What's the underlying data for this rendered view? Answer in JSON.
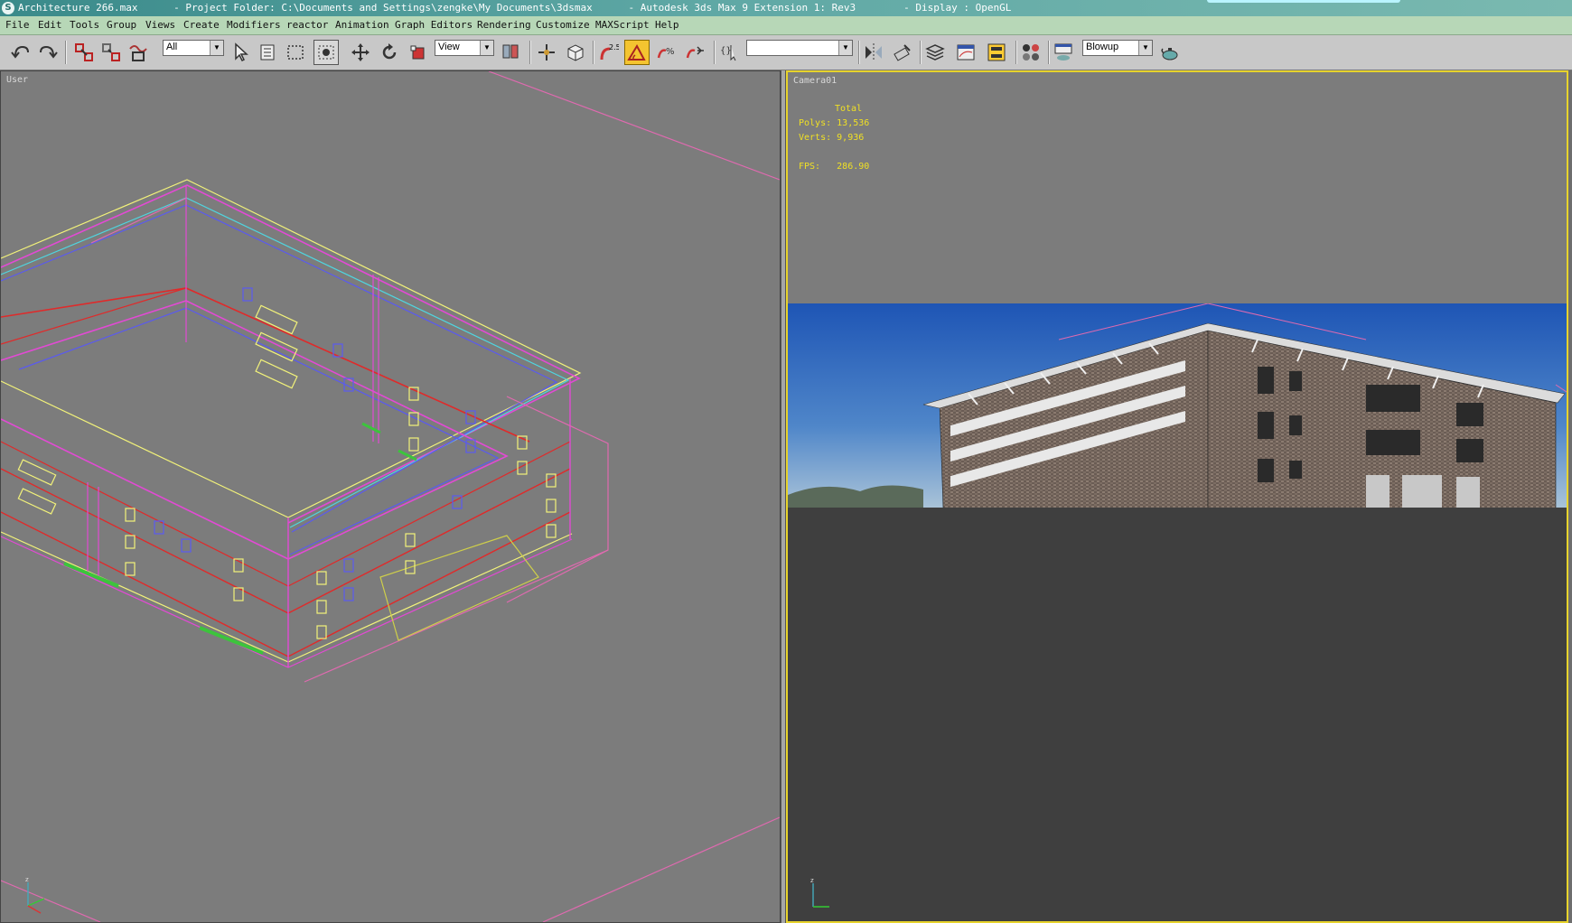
{
  "titlebar": {
    "icon_letter": "S",
    "title": "Architecture 266.max      - Project Folder: C:\\Documents and Settings\\zengke\\My Documents\\3dsmax      - Autodesk 3ds Max 9 Extension 1: Rev3        - Display : OpenGL"
  },
  "menu": {
    "items": [
      "File",
      "Edit",
      "Tools",
      "Group",
      "Views",
      "Create",
      "Modifiers",
      "reactor",
      "Animation",
      "Graph Editors",
      "Rendering",
      "Customize",
      "MAXScript",
      "Help"
    ]
  },
  "toolbar": {
    "selection_filter": "All",
    "reference_coord": "View",
    "named_selection": "",
    "render_type": "Blowup",
    "snap_label": "2.5",
    "icons": [
      "undo-icon",
      "redo-icon",
      "select-and-link-icon",
      "unlink-icon",
      "bind-space-warp-icon",
      "select-object-icon",
      "select-by-name-icon",
      "rectangular-selection-icon",
      "window-crossing-icon",
      "move-icon",
      "rotate-icon",
      "scale-icon",
      "pivot-center-icon",
      "select-manipulate-icon",
      "keyboard-shortcut-icon",
      "snaps-toggle-icon",
      "angle-snap-icon",
      "percent-snap-icon",
      "spinner-snap-icon",
      "edit-named-selection-icon",
      "mirror-icon",
      "align-icon",
      "layer-manager-icon",
      "curve-editor-icon",
      "schematic-view-icon",
      "material-editor-icon",
      "render-setup-icon",
      "quick-render-icon"
    ]
  },
  "viewports": {
    "left": {
      "label": "User"
    },
    "right": {
      "label": "Camera01",
      "stats": {
        "header": "Total",
        "polys_label": "Polys:",
        "polys": "13,536",
        "verts_label": "Verts:",
        "verts": "9,936",
        "fps_label": "FPS:",
        "fps": "286.90"
      }
    }
  },
  "colors": {
    "active_viewport_border": "#e7d32c",
    "stats_text": "#f0e024",
    "menubar_bg": "#b7d7b7",
    "titlebar_bg": "#5fa8a5"
  }
}
